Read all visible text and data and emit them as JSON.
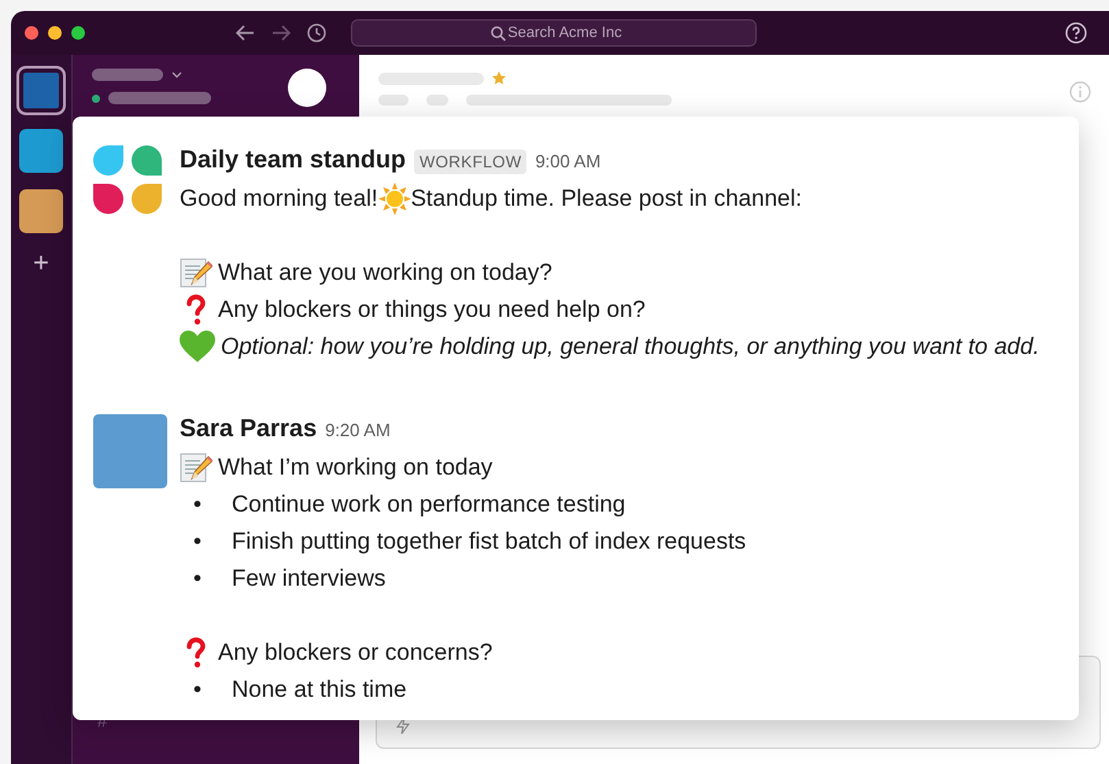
{
  "window": {
    "search": {
      "placeholder": "Search Acme Inc"
    }
  },
  "workspaces": [
    {
      "color": "#1e62a8",
      "selected": true
    },
    {
      "color": "#1d9bd1",
      "selected": false
    },
    {
      "color": "#d59a55",
      "selected": false
    }
  ],
  "add_workspace": "+",
  "sidebar": {
    "channel_prefix": "#"
  },
  "messages": [
    {
      "avatar": {
        "kind": "logo"
      },
      "author": "Daily team standup",
      "badge": "WORKFLOW",
      "time": "9:00 AM",
      "lines": [
        {
          "kind": "greeting",
          "before": "Good morning teal!",
          "after": "Standup time. Please post in channel:"
        },
        {
          "kind": "memo",
          "text": "What are you working on today?"
        },
        {
          "kind": "question",
          "text": "Any blockers or things you need help on?"
        },
        {
          "kind": "heart",
          "text": "Optional: how you’re holding up, general thoughts, or anything you want to add.",
          "italic": true
        }
      ]
    },
    {
      "avatar": {
        "kind": "square",
        "color": "#5b9bcf"
      },
      "author": "Sara Parras",
      "time": "9:20 AM",
      "lines": [
        {
          "kind": "memo",
          "text": "What I’m working on today"
        },
        {
          "kind": "bullet",
          "bullet": "•",
          "text": "Continue work on performance testing"
        },
        {
          "kind": "bullet",
          "bullet": "•",
          "text": "Finish putting together fist batch of index requests"
        },
        {
          "kind": "bullet",
          "bullet": "•",
          "text": "Few interviews"
        },
        {
          "kind": "question",
          "text": "Any blockers or concerns?"
        },
        {
          "kind": "bullet",
          "bullet": "•",
          "text": "None at this time"
        }
      ]
    }
  ]
}
